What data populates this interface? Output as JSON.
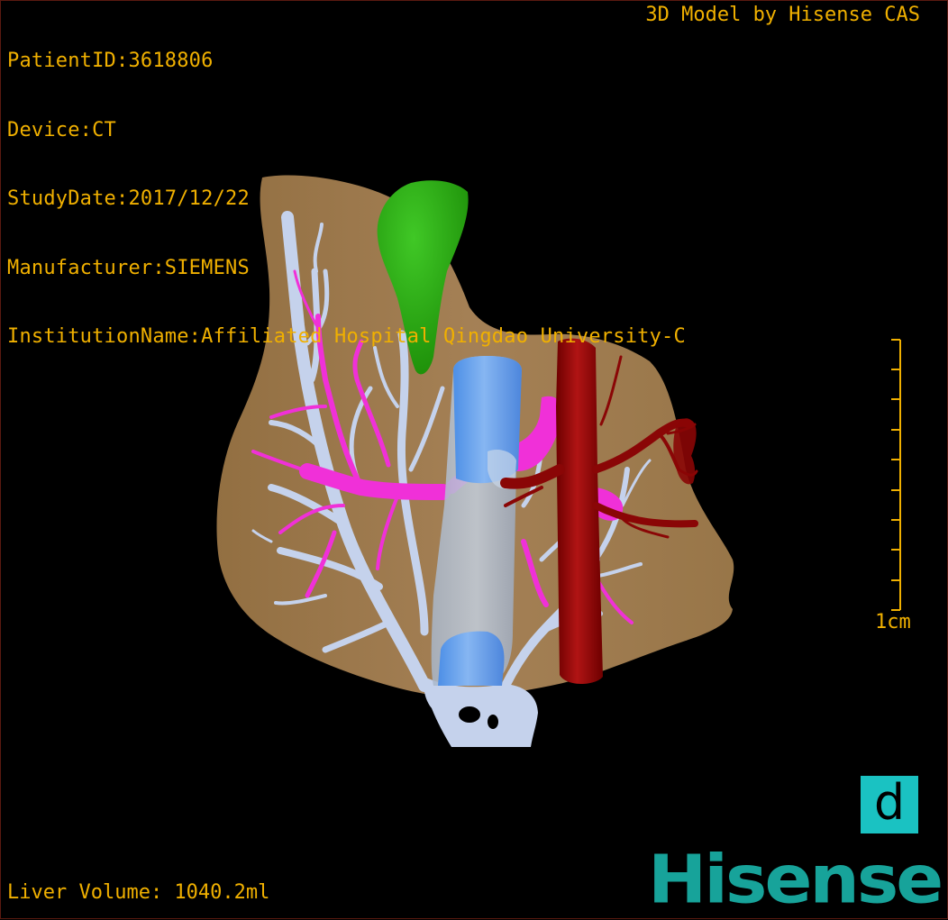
{
  "patient_info": {
    "patient_id": "PatientID:3618806",
    "device": "Device:CT",
    "study_date": "StudyDate:2017/12/22",
    "manufacturer": "Manufacturer:SIEMENS",
    "institution": "InstitutionName:Affiliated Hospital Qingdao University-C"
  },
  "model_credit": "3D Model by Hisense CAS",
  "liver_volume": "Liver Volume: 1040.2ml",
  "scale": {
    "label": "1cm",
    "color": "#f0b000"
  },
  "view_badge": "d",
  "brand": "Hisense",
  "colors": {
    "overlay_text": "#f0b000",
    "liver": "#a88050",
    "portal_vein": "#c5d2ec",
    "hepatic_artery_pink": "#f030d8",
    "ivc_blue": "#6aa6f0",
    "aorta_red": "#9a0a0a",
    "gallbladder_green": "#2aaa10",
    "badge": "#1ac2c2",
    "brand": "#17a39a"
  },
  "structures": {
    "liver": "liver-surface",
    "gallbladder": "gallbladder",
    "vena_cava": "inferior-vena-cava",
    "aorta": "aorta",
    "portal_vein": "portal-vein-tree",
    "hepatic_artery": "hepatic-artery-tree"
  }
}
